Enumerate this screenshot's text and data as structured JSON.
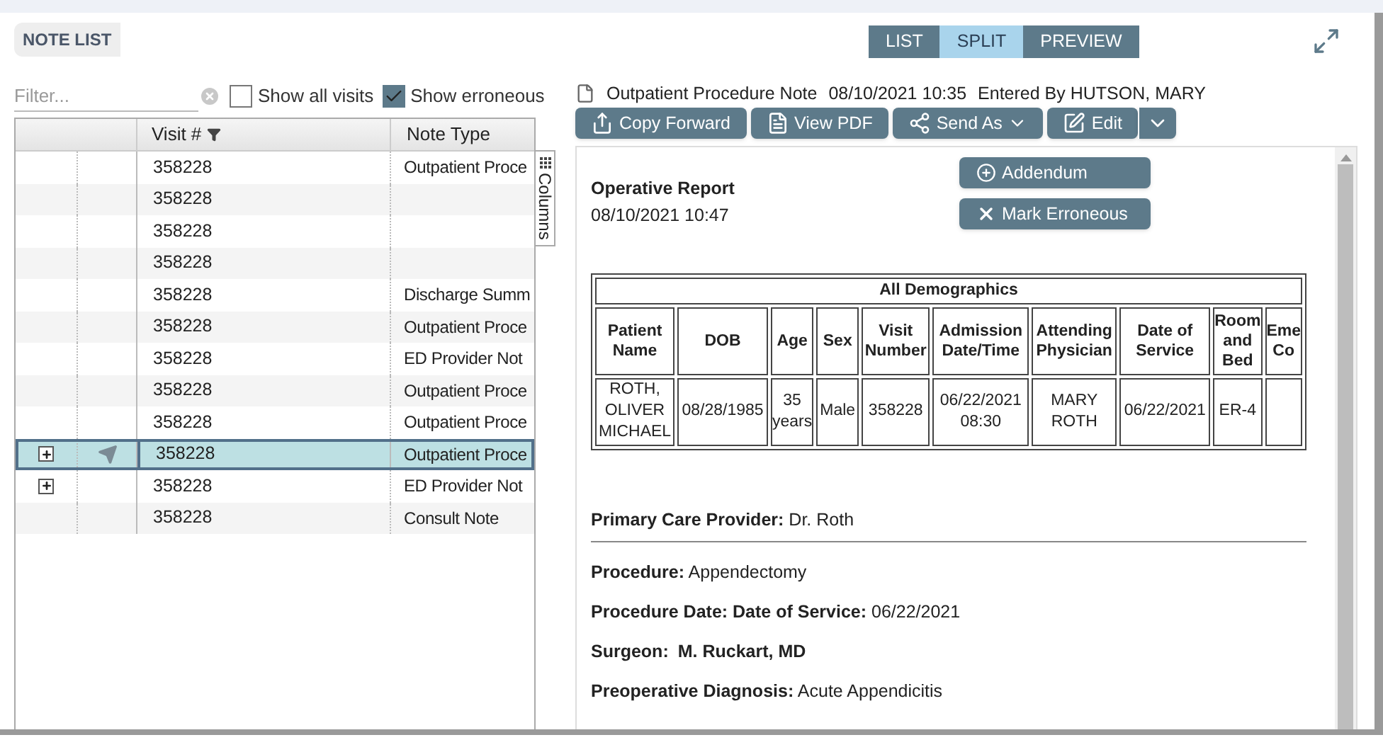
{
  "note_list": {
    "title": "NOTE LIST",
    "filter": {
      "placeholder": "Filter..."
    },
    "options": [
      {
        "label": "Show all visits",
        "checked": false
      },
      {
        "label": "Show erroneous",
        "checked": true
      }
    ],
    "columns": [
      "Visit #",
      "Note Type"
    ],
    "side_tab": "Columns",
    "rows": [
      {
        "visit": "358228",
        "note_type": "Outpatient Proce",
        "expandable": false,
        "sent": false,
        "selected": false
      },
      {
        "visit": "358228",
        "expandable": false,
        "sent": false,
        "selected": false
      },
      {
        "visit": "358228",
        "expandable": false,
        "sent": false,
        "selected": false
      },
      {
        "visit": "358228",
        "expandable": false,
        "sent": false,
        "selected": false
      },
      {
        "visit": "358228",
        "note_type": "Discharge Summ",
        "expandable": false,
        "sent": false,
        "selected": false
      },
      {
        "visit": "358228",
        "note_type": "Outpatient Proce",
        "expandable": false,
        "sent": false,
        "selected": false
      },
      {
        "visit": "358228",
        "note_type": "ED Provider Not",
        "expandable": false,
        "sent": false,
        "selected": false
      },
      {
        "visit": "358228",
        "note_type": "Outpatient Proce",
        "expandable": false,
        "sent": false,
        "selected": false
      },
      {
        "visit": "358228",
        "note_type": "Outpatient Proce",
        "expandable": false,
        "sent": false,
        "selected": false
      },
      {
        "visit": "358228",
        "note_type": "Outpatient Proce",
        "expandable": true,
        "sent": true,
        "selected": true
      },
      {
        "visit": "358228",
        "note_type": "ED Provider Not",
        "expandable": true,
        "sent": false,
        "selected": false
      },
      {
        "visit": "358228",
        "note_type": "Consult Note",
        "expandable": false,
        "sent": false,
        "selected": false
      }
    ]
  },
  "view_modes": [
    {
      "label": "LIST",
      "selected": false
    },
    {
      "label": "SPLIT",
      "selected": true
    },
    {
      "label": "PREVIEW",
      "selected": false
    }
  ],
  "note": {
    "title": "Outpatient Procedure Note",
    "datetime": "08/10/2021 10:35",
    "entered_by": "Entered By HUTSON, MARY",
    "actions": [
      {
        "kind": "copy",
        "label": "Copy Forward"
      },
      {
        "kind": "pdf",
        "label": "View PDF"
      },
      {
        "kind": "send",
        "label": "Send As"
      },
      {
        "kind": "edit",
        "label": "Edit"
      },
      {
        "kind": "more"
      }
    ],
    "menu": [
      {
        "kind": "add",
        "label": "Addendum"
      },
      {
        "kind": "erroneous",
        "label": "Mark Erroneous"
      }
    ],
    "report_title": "Operative Report",
    "report_datetime": "08/10/2021 10:47",
    "demographics": {
      "title": "All Demographics",
      "headers": [
        "Patient Name",
        "DOB",
        "Age",
        "Sex",
        "Visit Number",
        "Admission Date/Time",
        "Attending Physician",
        "Date of Service",
        "Room and Bed",
        "Eme Co"
      ],
      "row": [
        "ROTH, OLIVER MICHAEL",
        "08/28/1985",
        "35 years",
        "Male",
        "358228",
        "06/22/2021 08:30",
        "MARY ROTH",
        "06/22/2021",
        "ER-4"
      ]
    },
    "fields": [
      {
        "label": "Primary Care Provider:",
        "value": "Dr. Roth",
        "emphasized": false,
        "divider_after": true
      },
      {
        "label": "Procedure:",
        "value": "Appendectomy",
        "emphasized": false,
        "divider_after": false
      },
      {
        "label": "Procedure Date: Date of Service:",
        "value": "06/22/2021",
        "emphasized": false,
        "divider_after": false
      },
      {
        "label": "Surgeon:",
        "value": "M. Ruckart, MD",
        "emphasized": true,
        "divider_after": false
      },
      {
        "label": "Preoperative Diagnosis:",
        "value": "Acute Appendicitis",
        "emphasized": false,
        "divider_after": false
      }
    ]
  }
}
